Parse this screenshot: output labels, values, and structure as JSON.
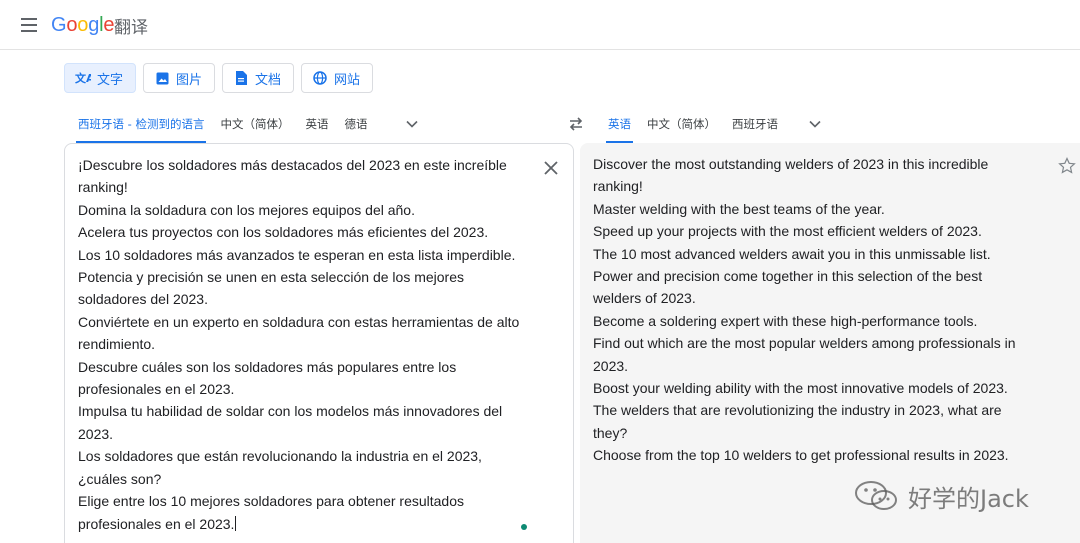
{
  "header": {
    "logo_letters": [
      {
        "ch": "G",
        "color": "#4285f4"
      },
      {
        "ch": "o",
        "color": "#ea4335"
      },
      {
        "ch": "o",
        "color": "#fbbc05"
      },
      {
        "ch": "g",
        "color": "#4285f4"
      },
      {
        "ch": "l",
        "color": "#34a853"
      },
      {
        "ch": "e",
        "color": "#ea4335"
      }
    ],
    "product_name": "翻译",
    "menu_icon": "hamburger-menu-icon"
  },
  "mode_tabs": [
    {
      "label": "文字",
      "icon": "translate-icon",
      "active": true
    },
    {
      "label": "图片",
      "icon": "image-icon",
      "active": false
    },
    {
      "label": "文档",
      "icon": "document-icon",
      "active": false
    },
    {
      "label": "网站",
      "icon": "globe-icon",
      "active": false
    }
  ],
  "source_languages": {
    "items": [
      "西班牙语 - 检测到的语言",
      "中文（简体）",
      "英语",
      "德语"
    ],
    "active_index": 0
  },
  "target_languages": {
    "items": [
      "英语",
      "中文（简体）",
      "西班牙语"
    ],
    "active_index": 0
  },
  "source_text": {
    "lines": [
      "¡Descubre los soldadores más destacados del 2023 en este increíble",
      "ranking!",
      "Domina la soldadura con los mejores equipos del año.",
      "Acelera tus proyectos con los soldadores más eficientes del 2023.",
      "Los 10 soldadores más avanzados te esperan en esta lista imperdible.",
      "Potencia y precisión se unen en esta selección de los mejores",
      "soldadores del 2023.",
      "Conviértete en un experto en soldadura con estas herramientas de alto",
      "rendimiento.",
      "Descubre cuáles son los soldadores más populares entre los",
      "profesionales en el 2023.",
      "Impulsa tu habilidad de soldar con los modelos más innovadores del",
      "2023.",
      "Los soldadores que están revolucionando la industria en el 2023,",
      "¿cuáles son?",
      "Elige entre los 10 mejores soldadores para obtener resultados",
      "profesionales en el 2023."
    ]
  },
  "translated_text": {
    "lines": [
      "Discover the most outstanding welders of 2023 in this incredible",
      "ranking!",
      "Master welding with the best teams of the year.",
      "Speed up your projects with the most efficient welders of 2023.",
      "The 10 most advanced welders await you in this unmissable list.",
      "Power and precision come together in this selection of the best",
      "welders of 2023.",
      "Become a soldering expert with these high-performance tools.",
      "Find out which are the most popular welders among professionals in",
      "2023.",
      "Boost your welding ability with the most innovative models of 2023.",
      "The welders that are revolutionizing the industry in 2023, what are",
      "they?",
      "Choose from the top 10 welders to get professional results in 2023."
    ]
  },
  "watermark": {
    "text": "好学的Jack",
    "icon": "wechat-icon"
  },
  "colors": {
    "accent": "#1a73e8",
    "active_tab_bg": "#e8f0fe",
    "target_bg": "#f5f5f5",
    "status_dot": "#0d8a73"
  }
}
